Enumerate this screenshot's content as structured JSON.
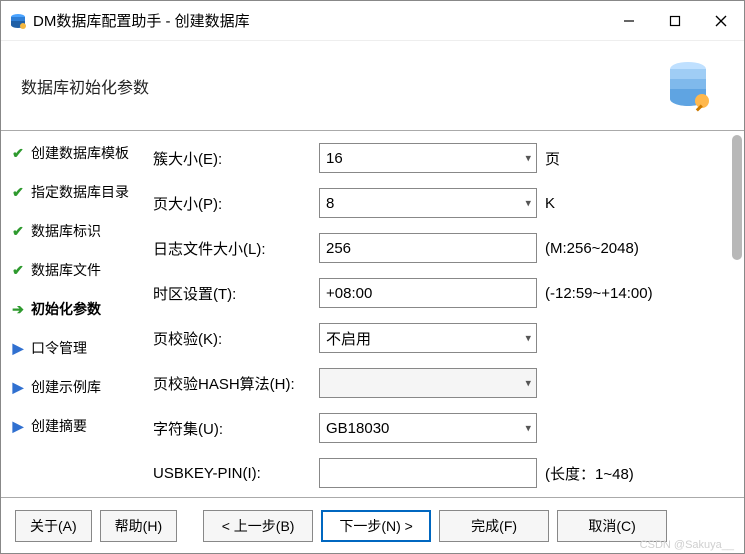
{
  "window": {
    "title": "DM数据库配置助手 - 创建数据库"
  },
  "header": {
    "title": "数据库初始化参数"
  },
  "sidebar": {
    "steps": [
      {
        "label": "创建数据库模板",
        "state": "done"
      },
      {
        "label": "指定数据库目录",
        "state": "done"
      },
      {
        "label": "数据库标识",
        "state": "done"
      },
      {
        "label": "数据库文件",
        "state": "done"
      },
      {
        "label": "初始化参数",
        "state": "current"
      },
      {
        "label": "口令管理",
        "state": "pend"
      },
      {
        "label": "创建示例库",
        "state": "pend"
      },
      {
        "label": "创建摘要",
        "state": "pend"
      }
    ]
  },
  "form": {
    "cluster": {
      "label": "簇大小(E):",
      "value": "16",
      "unit": "页"
    },
    "page": {
      "label": "页大小(P):",
      "value": "8",
      "unit": "K"
    },
    "log": {
      "label": "日志文件大小(L):",
      "value": "256",
      "hint": "(M:256~2048)"
    },
    "timezone": {
      "label": "时区设置(T):",
      "value": "+08:00",
      "hint": "(-12:59~+14:00)"
    },
    "pagecheck": {
      "label": "页校验(K):",
      "value": "不启用"
    },
    "hash": {
      "label": "页校验HASH算法(H):",
      "value": ""
    },
    "charset": {
      "label": "字符集(U):",
      "value": "GB18030"
    },
    "usbkey": {
      "label": "USBKEY-PIN(I):",
      "value": "",
      "hint": "(长度：1~48)"
    }
  },
  "footer": {
    "about": "关于(A)",
    "help": "帮助(H)",
    "back": "< 上一步(B)",
    "next": "下一步(N) >",
    "finish": "完成(F)",
    "cancel": "取消(C)"
  },
  "watermark": "CSDN @Sakuya__"
}
